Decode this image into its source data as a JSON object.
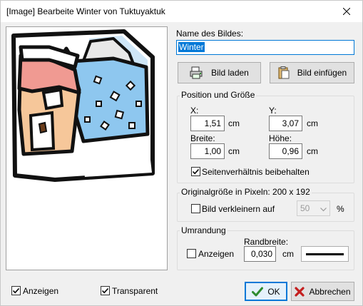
{
  "window": {
    "title": "[Image] Bearbeite Winter von Tuktuyaktuk"
  },
  "name": {
    "label": "Name des Bildes:",
    "value": "Winter"
  },
  "buttons": {
    "load": "Bild laden",
    "paste": "Bild einfügen",
    "ok": "OK",
    "cancel": "Abbrechen"
  },
  "position": {
    "title": "Position und Größe",
    "x_label": "X:",
    "x_value": "1,51",
    "x_unit": "cm",
    "y_label": "Y:",
    "y_value": "3,07",
    "y_unit": "cm",
    "w_label": "Breite:",
    "w_value": "1,00",
    "w_unit": "cm",
    "h_label": "Höhe:",
    "h_value": "0,96",
    "h_unit": "cm",
    "aspect_label": "Seitenverhältnis beibehalten",
    "aspect_checked": true
  },
  "original": {
    "title": "Originalgröße in Pixeln: 200 x 192",
    "shrink_label": "Bild verkleinern auf",
    "shrink_checked": false,
    "shrink_value": "50",
    "shrink_unit": "%"
  },
  "border": {
    "title": "Umrandung",
    "width_label": "Randbreite:",
    "show_label": "Anzeigen",
    "show_checked": false,
    "width_value": "0,030",
    "width_unit": "cm"
  },
  "footer": {
    "show_label": "Anzeigen",
    "show_checked": true,
    "transparent_label": "Transparent",
    "transparent_checked": true
  },
  "colors": {
    "accent": "#0078d7",
    "ok_check": "#2e8b2e",
    "cancel_x": "#c41e1e"
  }
}
